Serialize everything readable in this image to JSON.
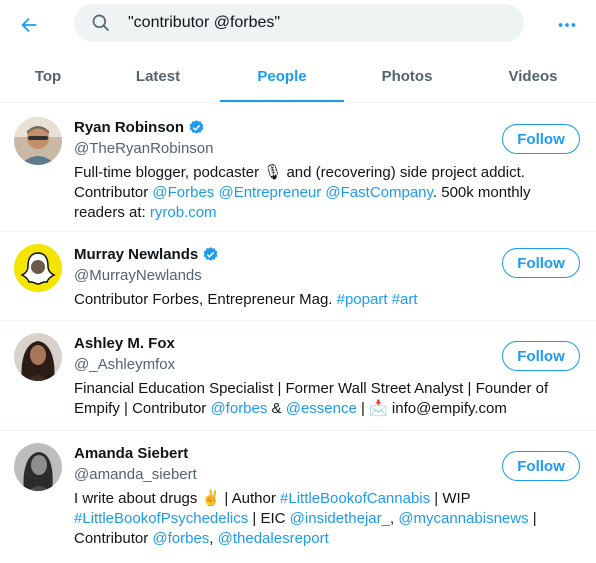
{
  "search": {
    "query": "\"contributor @forbes\""
  },
  "tabs": [
    {
      "label": "Top"
    },
    {
      "label": "Latest"
    },
    {
      "label": "People"
    },
    {
      "label": "Photos"
    },
    {
      "label": "Videos"
    }
  ],
  "active_tab": "People",
  "colors": {
    "accent": "#1d9bf0",
    "muted": "#536471",
    "text": "#0f1419",
    "search_bg": "#eff3f4"
  },
  "follow_label": "Follow",
  "results": [
    {
      "name": "Ryan Robinson",
      "handle": "@TheRyanRobinson",
      "verified": true,
      "bio": [
        {
          "t": "Full-time blogger, podcaster 🎙 and (recovering) side project addict. Contributor ",
          "link": false
        },
        {
          "t": "@Forbes",
          "link": true
        },
        {
          "t": " ",
          "link": false
        },
        {
          "t": "@Entrepreneur",
          "link": true
        },
        {
          "t": " ",
          "link": false
        },
        {
          "t": "@FastCompany",
          "link": true
        },
        {
          "t": ". 500k monthly readers at: ",
          "link": false
        },
        {
          "t": "ryrob.com",
          "link": true
        }
      ]
    },
    {
      "name": "Murray Newlands",
      "handle": "@MurrayNewlands",
      "verified": true,
      "bio": [
        {
          "t": "Contributor Forbes, Entrepreneur Mag. ",
          "link": false
        },
        {
          "t": "#popart",
          "link": true
        },
        {
          "t": " ",
          "link": false
        },
        {
          "t": "#art",
          "link": true
        }
      ]
    },
    {
      "name": "Ashley M. Fox",
      "handle": "@_Ashleymfox",
      "verified": false,
      "bio": [
        {
          "t": "Financial Education Specialist | Former Wall Street Analyst | Founder of Empify | Contributor ",
          "link": false
        },
        {
          "t": "@forbes",
          "link": true
        },
        {
          "t": " & ",
          "link": false
        },
        {
          "t": "@essence",
          "link": true
        },
        {
          "t": " | 📩 info@empify.com",
          "link": false
        }
      ]
    },
    {
      "name": "Amanda Siebert",
      "handle": "@amanda_siebert",
      "verified": false,
      "bio": [
        {
          "t": "I write about drugs ✌ | Author ",
          "link": false
        },
        {
          "t": "#LittleBookofCannabis",
          "link": true
        },
        {
          "t": " | WIP ",
          "link": false
        },
        {
          "t": "#LittleBookofPsychedelics",
          "link": true
        },
        {
          "t": " | EIC ",
          "link": false
        },
        {
          "t": "@insidethejar_",
          "link": true
        },
        {
          "t": ", ",
          "link": false
        },
        {
          "t": "@mycannabisnews",
          "link": true
        },
        {
          "t": " | Contributor ",
          "link": false
        },
        {
          "t": "@forbes",
          "link": true
        },
        {
          "t": ", ",
          "link": false
        },
        {
          "t": "@thedalesreport",
          "link": true
        }
      ]
    }
  ]
}
